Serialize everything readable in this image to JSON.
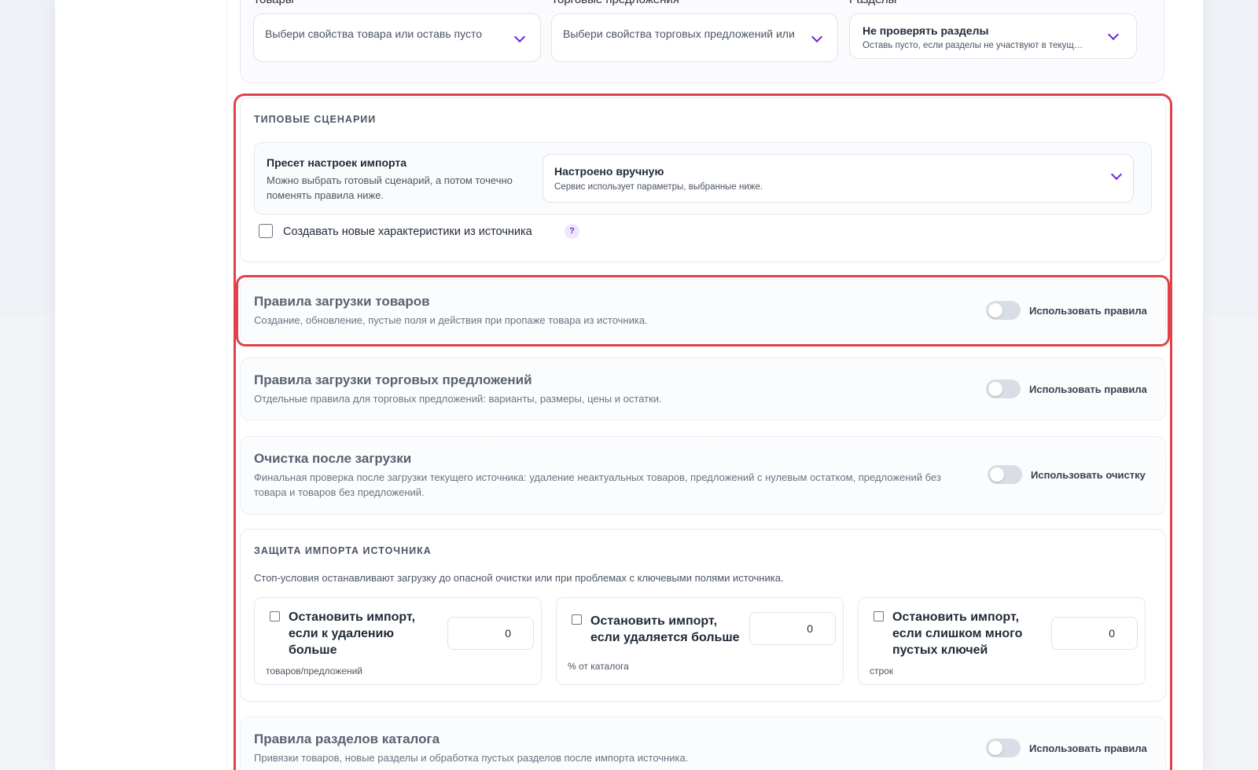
{
  "filters": {
    "products": {
      "label": "Товары",
      "placeholder": "Выбери свойства товара или оставь пусто"
    },
    "offers": {
      "label": "Торговые предложения",
      "placeholder": "Выбери свойства торговых предложений или"
    },
    "sections": {
      "label": "Разделы",
      "title": "Не проверять разделы",
      "subtitle": "Оставь пусто, если разделы не участвуют в текущ…"
    }
  },
  "scenarios": {
    "section_title": "ТИПОВЫЕ СЦЕНАРИИ",
    "preset_heading": "Пресет настроек импорта",
    "preset_desc": "Можно выбрать готовый сценарий, а потом точечно поменять правила ниже.",
    "preset_value": "Настроено вручную",
    "preset_value_desc": "Сервис использует параметры, выбранные ниже.",
    "create_chars_label": "Создавать новые характеристики из источника",
    "create_chars_checked": false,
    "help_glyph": "?"
  },
  "rules": {
    "products": {
      "title": "Правила загрузки товаров",
      "desc": "Создание, обновление, пустые поля и действия при пропаже товара из источника.",
      "toggle_label": "Использовать правила",
      "enabled": false
    },
    "offers": {
      "title": "Правила загрузки торговых предложений",
      "desc": "Отдельные правила для торговых предложений: варианты, размеры, цены и остатки.",
      "toggle_label": "Использовать правила",
      "enabled": false
    },
    "cleanup": {
      "title": "Очистка после загрузки",
      "desc": "Финальная проверка после загрузки текущего источника: удаление неактуальных товаров, предложений с нулевым остатком, предложений без товара и товаров без предложений.",
      "toggle_label": "Использовать очистку",
      "enabled": false
    },
    "catalog_sections": {
      "title": "Правила разделов каталога",
      "desc": "Привязки товаров, новые разделы и обработка пустых разделов после импорта источника.",
      "toggle_label": "Использовать правила",
      "enabled": false
    }
  },
  "protection": {
    "section_title": "ЗАЩИТА ИМПОРТА ИСТОЧНИКА",
    "desc": "Стоп-условия останавливают загрузку до опасной очистки или при проблемах с ключевыми полями источника.",
    "items": [
      {
        "line1": "Остановить импорт,",
        "line2": "если к удалению",
        "line3": "больше",
        "unit": "товаров/предложений",
        "value": "0",
        "checked": false
      },
      {
        "line1": "Остановить импорт,",
        "line2": "если удаляется больше",
        "line3": "",
        "unit": "% от каталога",
        "value": "0",
        "checked": false
      },
      {
        "line1": "Остановить импорт,",
        "line2": "если слишком много",
        "line3": "пустых ключей",
        "unit": "строк",
        "value": "0",
        "checked": false
      }
    ]
  },
  "colors": {
    "accent": "#6d28d9",
    "highlight": "#e0424b",
    "toggle_off": "#d9dde5"
  },
  "icons": {
    "dropdown": "chevron-down-icon",
    "help": "help-icon"
  }
}
